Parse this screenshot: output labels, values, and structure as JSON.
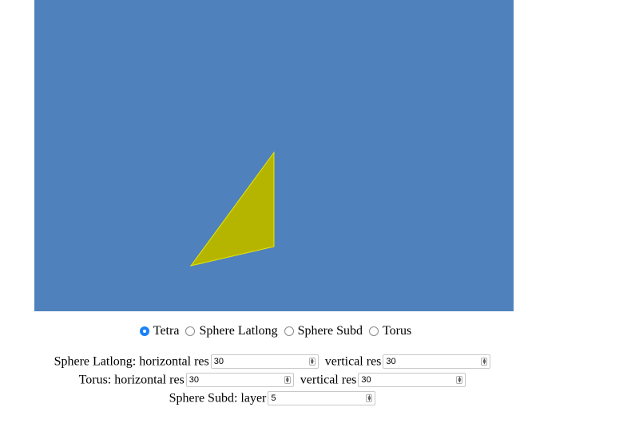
{
  "canvas": {
    "background_color": "#4f81bd",
    "shape_fill_color": "#b5b500",
    "shape_stroke_color": "#e6e600"
  },
  "shape_selector": {
    "options": [
      {
        "label": "Tetra",
        "checked": true
      },
      {
        "label": "Sphere Latlong",
        "checked": false
      },
      {
        "label": "Sphere Subd",
        "checked": false
      },
      {
        "label": "Torus",
        "checked": false
      }
    ]
  },
  "sphere_latlong": {
    "horizontal_label": "Sphere Latlong: horizontal res",
    "horizontal_value": "30",
    "vertical_label": "vertical res",
    "vertical_value": "30"
  },
  "torus": {
    "horizontal_label": "Torus: horizontal res",
    "horizontal_value": "30",
    "vertical_label": "vertical res",
    "vertical_value": "30"
  },
  "sphere_subd": {
    "layer_label": "Sphere Subd: layer",
    "layer_value": "5"
  }
}
